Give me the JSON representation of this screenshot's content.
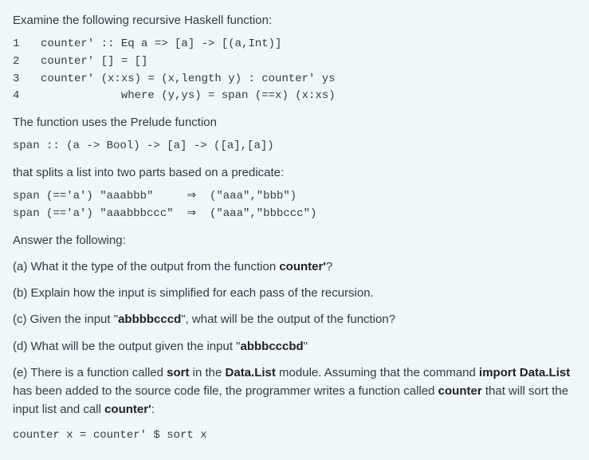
{
  "intro": "Examine the following recursive Haskell function:",
  "code": {
    "l1": "counter' :: Eq a => [a] -> [(a,Int)]",
    "l2": "counter' [] = []",
    "l3": "counter' (x:xs) = (x,length y) : counter' ys",
    "l4": "            where (y,ys) = span (==x) (x:xs)"
  },
  "prelude_intro": "The function uses the Prelude function",
  "span_sig": "span :: (a -> Bool) -> [a] -> ([a],[a])",
  "split_intro": "that splits a list into two parts based on a predicate:",
  "span_ex1": "span (=='a') \"aaabbb\"     ⇒  (\"aaa\",\"bbb\")",
  "span_ex2": "span (=='a') \"aaabbbccc\"  ⇒  (\"aaa\",\"bbbccc\")",
  "answer_intro": "Answer the following:",
  "qa_pre": "(a) What it the type of the output from the function ",
  "qa_bold": "counter'",
  "qa_post": "?",
  "qb": "(b) Explain how the input is simplified for each pass of the recursion.",
  "qc_pre": "(c) Given the input \"",
  "qc_bold": "abbbbcccd",
  "qc_post": "\", what will be the output of the function?",
  "qd_pre": "(d) What will be the output given the input \"",
  "qd_bold": "abbbcccbd",
  "qd_post": "\"",
  "qe": {
    "p1": "(e) There is a function called ",
    "b1": "sort",
    "p2": " in the ",
    "b2": "Data.List",
    "p3": " module. Assuming that the command ",
    "b3": "import Data.List",
    "p4": " has been added to the source code file, the programmer writes a function called ",
    "b4": "counter",
    "p5": " that will sort the input list and call ",
    "b5": "counter'",
    "p6": ":"
  },
  "counter_def": "counter x = counter' $ sort x"
}
